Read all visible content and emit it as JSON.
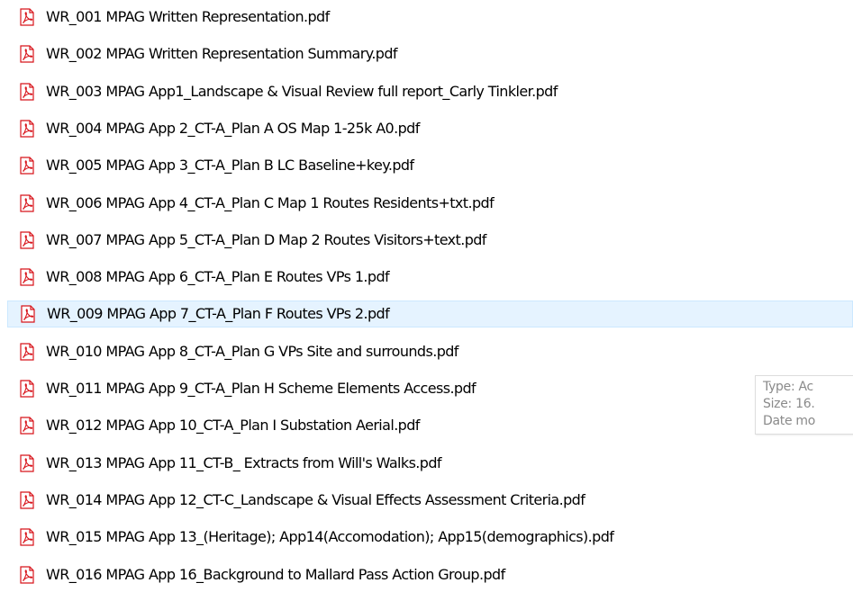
{
  "files": [
    {
      "name": "WR_001 MPAG Written Representation.pdf",
      "icon": "pdf-icon",
      "hovered": false
    },
    {
      "name": "WR_002 MPAG Written Representation Summary.pdf",
      "icon": "pdf-icon",
      "hovered": false
    },
    {
      "name": "WR_003 MPAG App1_Landscape & Visual Review full report_Carly Tinkler.pdf",
      "icon": "pdf-icon",
      "hovered": false
    },
    {
      "name": "WR_004 MPAG App 2_CT-A_Plan A OS Map 1-25k A0.pdf",
      "icon": "pdf-icon",
      "hovered": false
    },
    {
      "name": "WR_005 MPAG App 3_CT-A_Plan B LC Baseline+key.pdf",
      "icon": "pdf-icon",
      "hovered": false
    },
    {
      "name": "WR_006 MPAG App 4_CT-A_Plan C Map 1 Routes Residents+txt.pdf",
      "icon": "pdf-icon",
      "hovered": false
    },
    {
      "name": "WR_007 MPAG App 5_CT-A_Plan D Map 2 Routes Visitors+text.pdf",
      "icon": "pdf-icon",
      "hovered": false
    },
    {
      "name": "WR_008 MPAG App 6_CT-A_Plan E Routes VPs 1.pdf",
      "icon": "pdf-icon",
      "hovered": false
    },
    {
      "name": "WR_009 MPAG App 7_CT-A_Plan F Routes VPs 2.pdf",
      "icon": "pdf-icon",
      "hovered": true
    },
    {
      "name": "WR_010 MPAG App 8_CT-A_Plan G VPs Site and surrounds.pdf",
      "icon": "pdf-icon",
      "hovered": false
    },
    {
      "name": "WR_011 MPAG App 9_CT-A_Plan H Scheme Elements Access.pdf",
      "icon": "pdf-icon",
      "hovered": false
    },
    {
      "name": "WR_012 MPAG App 10_CT-A_Plan I Substation Aerial.pdf",
      "icon": "pdf-icon",
      "hovered": false
    },
    {
      "name": "WR_013 MPAG App 11_CT-B_ Extracts from Will's Walks.pdf",
      "icon": "pdf-icon",
      "hovered": false
    },
    {
      "name": "WR_014 MPAG App 12_CT-C_Landscape & Visual Effects Assessment Criteria.pdf",
      "icon": "pdf-icon",
      "hovered": false
    },
    {
      "name": "WR_015 MPAG App 13_(Heritage); App14(Accomodation); App15(demographics).pdf",
      "icon": "pdf-icon",
      "hovered": false
    },
    {
      "name": "WR_016 MPAG App 16_Background to Mallard Pass Action Group.pdf",
      "icon": "pdf-icon",
      "hovered": false
    }
  ],
  "tooltip": {
    "type_line": "Type: Ac",
    "size_line": "Size: 16.",
    "date_line": "Date mo"
  },
  "colors": {
    "hover_background": "#e5f3ff",
    "hover_border": "#cce8ff",
    "pdf_red": "#d8141b",
    "tooltip_text": "#8a8a8a"
  }
}
